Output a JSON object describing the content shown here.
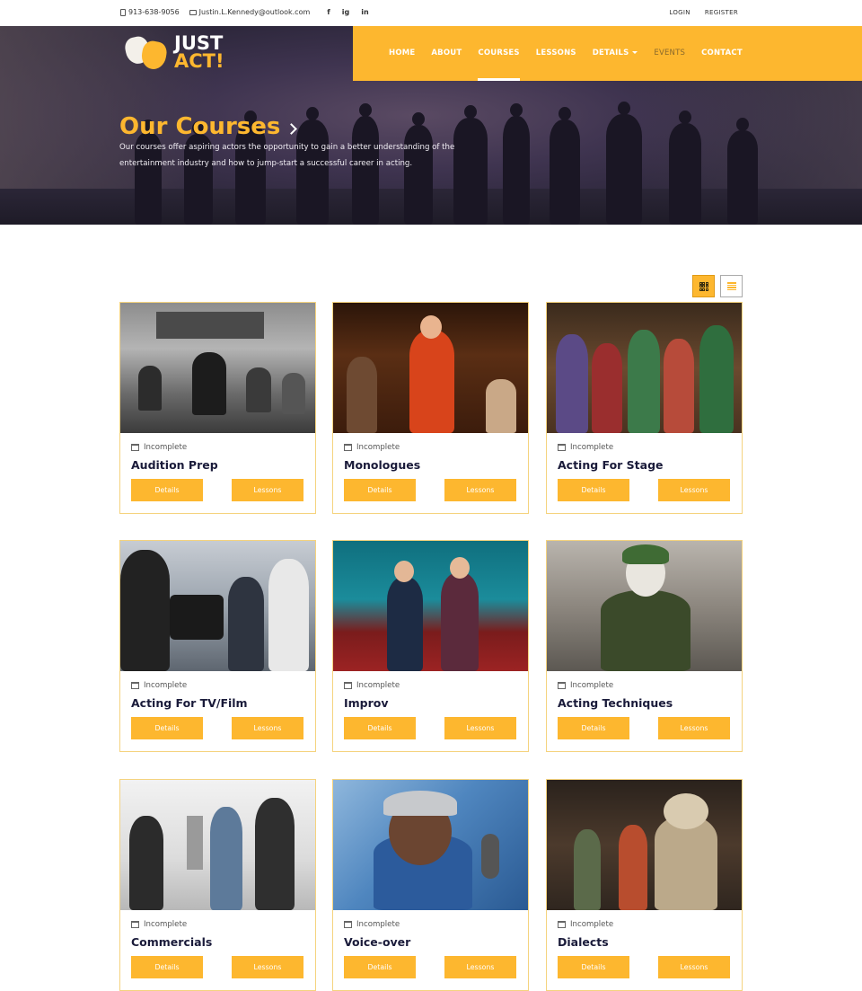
{
  "topbar": {
    "phone": "913-638-9056",
    "email": "Justin.L.Kennedy@outlook.com",
    "social": [
      "f",
      "ig",
      "in"
    ],
    "login": "LOGIN",
    "register": "REGISTER"
  },
  "logo": {
    "line1": "JUST",
    "line2": "ACT!"
  },
  "nav": {
    "items": [
      {
        "label": "HOME"
      },
      {
        "label": "ABOUT"
      },
      {
        "label": "COURSES"
      },
      {
        "label": "LESSONS"
      },
      {
        "label": "DETAILS"
      },
      {
        "label": "EVENTS"
      },
      {
        "label": "CONTACT"
      }
    ],
    "active": "COURSES"
  },
  "hero": {
    "title": "Our Courses",
    "description": "Our courses offer aspiring actors the opportunity to gain a better understanding of the entertainment industry and how to jump-start a successful career in acting."
  },
  "courses": [
    {
      "status": "Incomplete",
      "title": "Audition Prep",
      "details": "Details",
      "lessons": "Lessons"
    },
    {
      "status": "Incomplete",
      "title": "Monologues",
      "details": "Details",
      "lessons": "Lessons"
    },
    {
      "status": "Incomplete",
      "title": "Acting For Stage",
      "details": "Details",
      "lessons": "Lessons"
    },
    {
      "status": "Incomplete",
      "title": "Acting For TV/Film",
      "details": "Details",
      "lessons": "Lessons"
    },
    {
      "status": "Incomplete",
      "title": "Improv",
      "details": "Details",
      "lessons": "Lessons"
    },
    {
      "status": "Incomplete",
      "title": "Acting Techniques",
      "details": "Details",
      "lessons": "Lessons"
    },
    {
      "status": "Incomplete",
      "title": "Commercials",
      "details": "Details",
      "lessons": "Lessons"
    },
    {
      "status": "Incomplete",
      "title": "Voice-over",
      "details": "Details",
      "lessons": "Lessons"
    },
    {
      "status": "Incomplete",
      "title": "Dialects",
      "details": "Details",
      "lessons": "Lessons"
    }
  ],
  "colors": {
    "accent": "#fdb72f",
    "navy": "#1a1b3a"
  }
}
